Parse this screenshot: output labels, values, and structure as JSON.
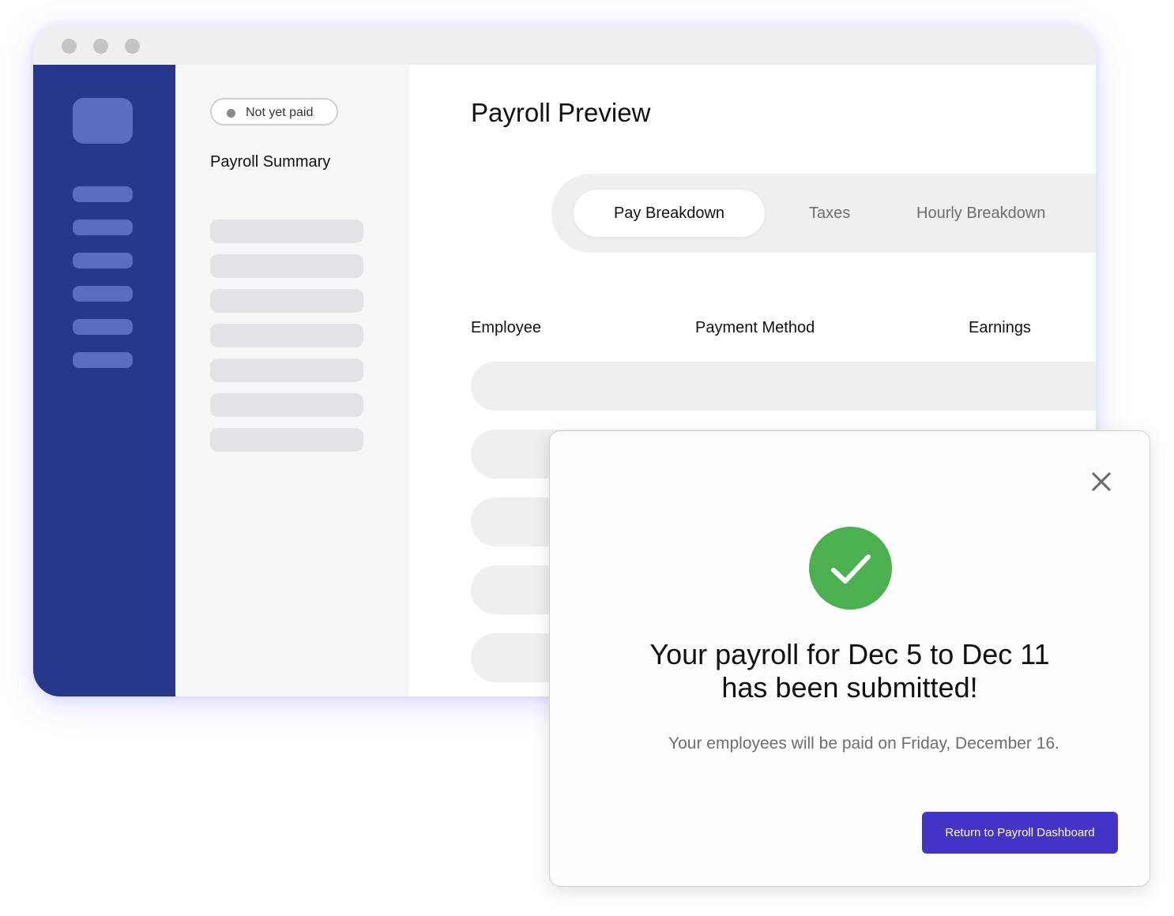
{
  "window": {
    "title_dots": [
      "close",
      "minimize",
      "maximize"
    ]
  },
  "summary": {
    "status_pill": "Not yet paid",
    "title": "Payroll Summary"
  },
  "main": {
    "title": "Payroll Preview",
    "tabs": [
      {
        "label": "Pay Breakdown",
        "active": true
      },
      {
        "label": "Taxes",
        "active": false
      },
      {
        "label": "Hourly Breakdown",
        "active": false
      }
    ],
    "columns": [
      "Employee",
      "Payment Method",
      "Earnings"
    ]
  },
  "modal": {
    "icon": "check-circle-icon",
    "title_line1": "Your payroll for Dec 5 to Dec 11",
    "title_line2": "has been submitted!",
    "subtitle": "Your employees will be paid on Friday, December 16.",
    "button_label": "Return to Payroll Dashboard"
  },
  "colors": {
    "sidebar": "#26378d",
    "accent_button": "#4433c7",
    "success": "#4caf50"
  }
}
